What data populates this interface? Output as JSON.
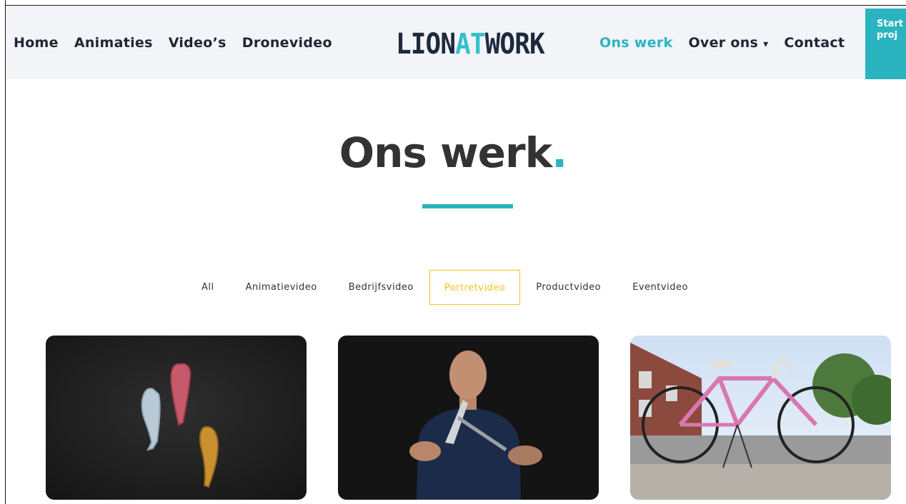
{
  "header": {
    "nav_left": [
      {
        "label": "Home"
      },
      {
        "label": "Animaties"
      },
      {
        "label": "Video’s"
      },
      {
        "label": "Dronevideo"
      }
    ],
    "logo": {
      "part1": "LION",
      "part2": "AT",
      "part3": "WORK"
    },
    "nav_right": [
      {
        "label": "Ons werk",
        "active": true
      },
      {
        "label": "Over ons",
        "caret": "▾"
      },
      {
        "label": "Contact"
      }
    ],
    "cta_label": "Start\nproj"
  },
  "hero": {
    "title": "Ons werk",
    "title_dot": "."
  },
  "filters": [
    {
      "label": "All"
    },
    {
      "label": "Animatievideo"
    },
    {
      "label": "Bedrijfsvideo"
    },
    {
      "label": "Portretvideo",
      "active": true
    },
    {
      "label": "Productvideo"
    },
    {
      "label": "Eventvideo"
    }
  ],
  "colors": {
    "accent": "#2ab4c0",
    "active_filter": "#f2c31f",
    "header_bg": "#f2f4f8",
    "nav_text": "#1f2633"
  }
}
